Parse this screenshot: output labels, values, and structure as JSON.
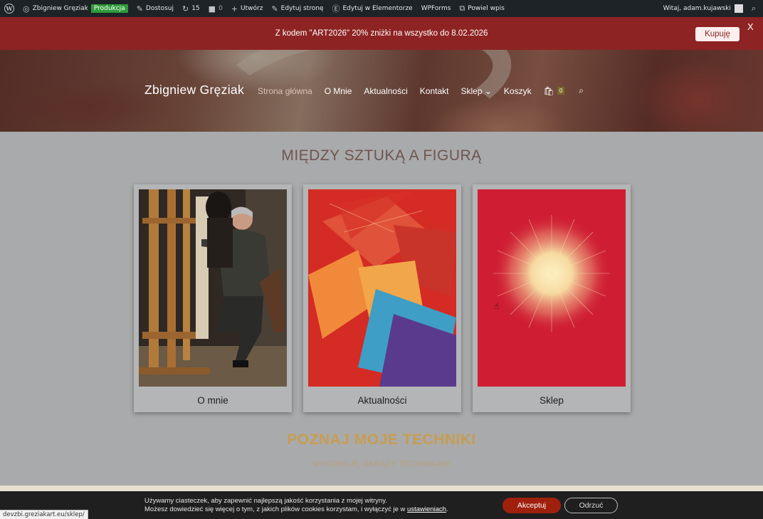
{
  "adminbar": {
    "site_name": "Zbigniew Gręziak",
    "env_badge": "Produkcja",
    "customize": "Dostosuj",
    "updates_count": "15",
    "comments_count": "0",
    "new": "Utwórz",
    "edit_page": "Edytuj stronę",
    "edit_elementor": "Edytuj w Elementorze",
    "wpforms": "WPForms",
    "duplicate": "Powiel wpis",
    "greeting": "Witaj, adam.kujawski"
  },
  "promo": {
    "text": "Z kodem \"ART2026\" 20% zniżki na wszystko do 8.02.2026",
    "button": "Kupuję",
    "close": "X"
  },
  "header": {
    "brand": "Zbigniew Gręziak",
    "menu": [
      "Strona główna",
      "O Mnie",
      "Aktualności",
      "Kontakt",
      "Sklep",
      "Koszyk"
    ],
    "cart_count": "0"
  },
  "main": {
    "title": "MIĘDZY SZTUKĄ A FIGURĄ",
    "cards": [
      "O mnie",
      "Aktualności",
      "Sklep"
    ],
    "techniques_title": "POZNAJ MOJE TECHNIKI",
    "techniques_sub": "WYKONUJĘ OBRAZY TECHNIKAMI"
  },
  "cookie": {
    "line1": "Używamy ciasteczek, aby zapewnić najlepszą jakość korzystania z mojej witryny.",
    "line2_pre": "Możesz dowiedzieć się więcej o tym, z jakich plików cookies korzystam, i wyłączyć je w ",
    "line2_link": "ustawieniach",
    "line2_post": ".",
    "accept": "Akceptuj",
    "reject": "Odrzuć"
  },
  "status_url": "devzbi.greziakart.eu/sklep/",
  "colors": {
    "adminbar_bg": "#1d2327",
    "promo_bg": "#8e2323",
    "page_bg": "#a9aaab",
    "techniques": "#c79d52",
    "accept_bg": "#a0200e"
  }
}
